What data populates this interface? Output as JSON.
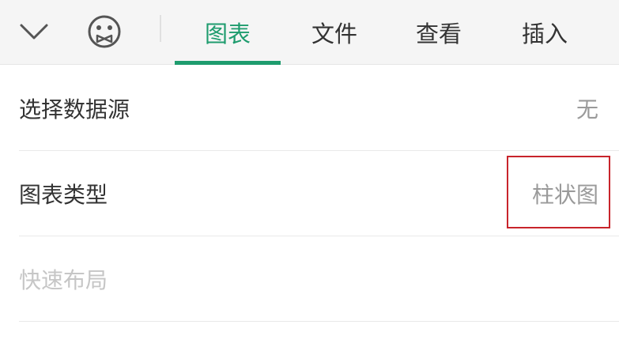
{
  "toolbar": {
    "icons": {
      "collapse": "chevron-down-icon",
      "emoji": "emoji-face-icon"
    },
    "tabs": [
      {
        "label": "图表",
        "active": true
      },
      {
        "label": "文件",
        "active": false
      },
      {
        "label": "查看",
        "active": false
      },
      {
        "label": "插入",
        "active": false
      }
    ]
  },
  "panel": {
    "data_source": {
      "label": "选择数据源",
      "value": "无"
    },
    "chart_type": {
      "label": "图表类型",
      "value": "柱状图",
      "highlighted": true
    },
    "quick_layout": {
      "label": "快速布局",
      "enabled": false
    }
  },
  "colors": {
    "accent": "#1e9c6e",
    "highlight_border": "#c8242b",
    "toolbar_bg": "#f5f5f5",
    "disabled_text": "#c6c6c6",
    "value_text": "#9a9a9a"
  }
}
